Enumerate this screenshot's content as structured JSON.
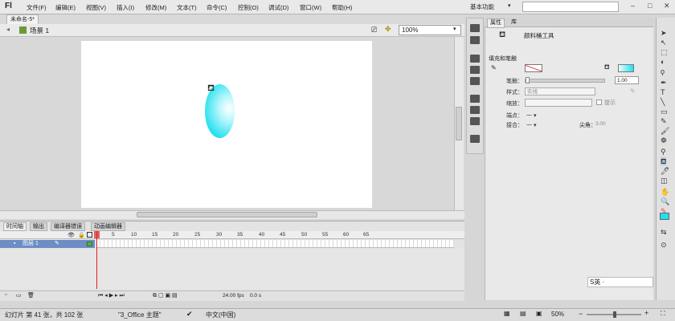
{
  "app": {
    "logo": "Fl"
  },
  "menu": [
    "文件(F)",
    "编辑(E)",
    "视图(V)",
    "插入(I)",
    "修改(M)",
    "文本(T)",
    "命令(C)",
    "控制(O)",
    "调试(D)",
    "窗口(W)",
    "帮助(H)"
  ],
  "workspace": "基本功能",
  "window_controls": {
    "minimize": "–",
    "maximize": "□",
    "close": "✕"
  },
  "document_tab": "未命名-5*",
  "scene": {
    "label": "场景 1"
  },
  "zoom": "100%",
  "timeline": {
    "tabs": [
      "时间轴",
      "输出",
      "编译器错误",
      "动画编辑器"
    ],
    "frame_numbers": [
      "5",
      "10",
      "15",
      "20",
      "25",
      "30",
      "35",
      "40",
      "45",
      "50",
      "55",
      "60",
      "65"
    ],
    "layer_name": "图层 1",
    "fps": "24.00 fps",
    "time": "0.0 s"
  },
  "properties": {
    "tabs": [
      "属性",
      "库"
    ],
    "tool_name": "颜料桶工具",
    "section_fill_stroke": "填充和笔触",
    "stroke_label": "笔触：",
    "stroke_value": "1.00",
    "style_label": "样式：",
    "style_value": "实线",
    "scale_label": "缩放：",
    "hint_label": "提示",
    "cap_label": "端点：",
    "cap_value": "一 ▾",
    "join_label": "接合：",
    "join_value": "一 ▾",
    "sharp_label": "尖角：",
    "sharp_value": "3.00",
    "fill_color": "#1fe1ee",
    "stroke_color": "#e44444"
  },
  "ime": "S英 ·",
  "status": {
    "slide": "幻灯片 第 41 张，共 102 张",
    "theme": "\"3_Office 主题\"",
    "language": "中文(中国)",
    "zoom": "50%"
  }
}
